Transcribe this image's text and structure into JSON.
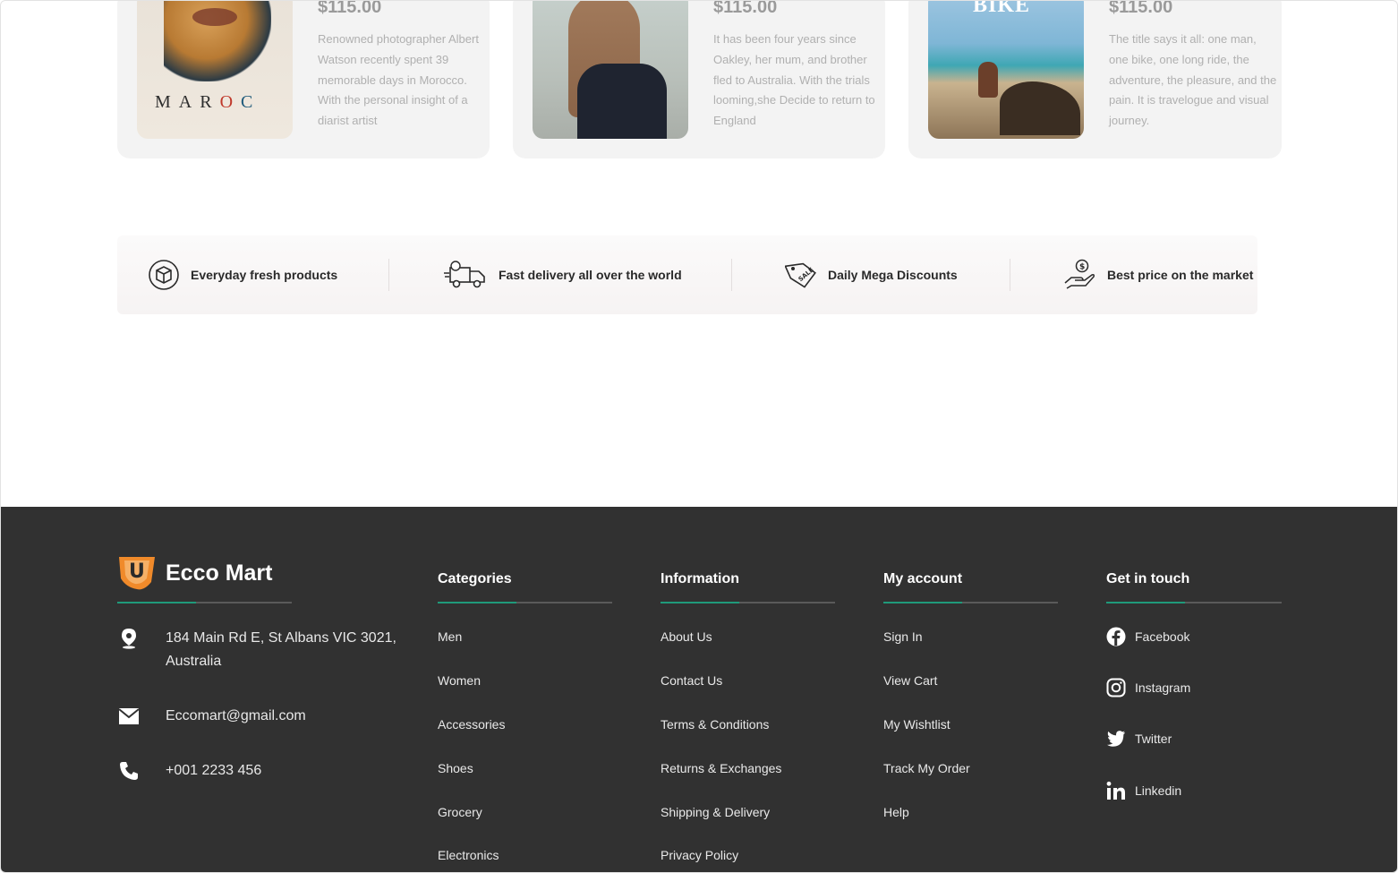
{
  "products": [
    {
      "price": "$115.00",
      "description": "Renowned photographer Albert Watson recently spent 39 memorable days in Morocco. With the personal insight of a diarist artist",
      "cover_title": "MAROC"
    },
    {
      "price": "$115.00",
      "description": "It has been four years since Oakley, her mum, and brother fled to Australia. With the trials looming,she Decide to return to England"
    },
    {
      "price": "$115.00",
      "description": "The title says it all: one man, one bike, one long ride, the adventure, the pleasure, and the pain. It is travelogue and visual journey.",
      "cover_title": "BIKE"
    }
  ],
  "features": [
    {
      "label": "Everyday fresh products",
      "icon": "box-icon"
    },
    {
      "label": "Fast delivery all over the world",
      "icon": "delivery-truck-icon"
    },
    {
      "label": "Daily Mega Discounts",
      "icon": "sale-tag-icon"
    },
    {
      "label": "Best price on the market",
      "icon": "hand-coin-icon"
    }
  ],
  "footer": {
    "brand": {
      "name": "Ecco Mart",
      "logo_letter": "U"
    },
    "address": "184 Main Rd E, St Albans VIC 3021, Australia",
    "email": "Eccomart@gmail.com",
    "phone": "+001 2233 456",
    "columns": {
      "categories": {
        "heading": "Categories",
        "links": [
          "Men",
          "Women",
          "Accessories",
          "Shoes",
          "Grocery",
          "Electronics"
        ]
      },
      "information": {
        "heading": "Information",
        "links": [
          "About Us",
          "Contact Us",
          "Terms & Conditions",
          "Returns & Exchanges",
          "Shipping & Delivery",
          "Privacy Policy"
        ]
      },
      "account": {
        "heading": "My account",
        "links": [
          "Sign In",
          "View Cart",
          "My Wishtlist",
          "Track My Order",
          "Help"
        ]
      },
      "contact": {
        "heading": "Get in touch",
        "links": [
          "Facebook",
          "Instagram",
          "Twitter",
          "Linkedin"
        ]
      }
    }
  },
  "colors": {
    "footer_bg": "#313131",
    "accent": "#1f9a7a",
    "brand_orange": "#f08a2a"
  }
}
